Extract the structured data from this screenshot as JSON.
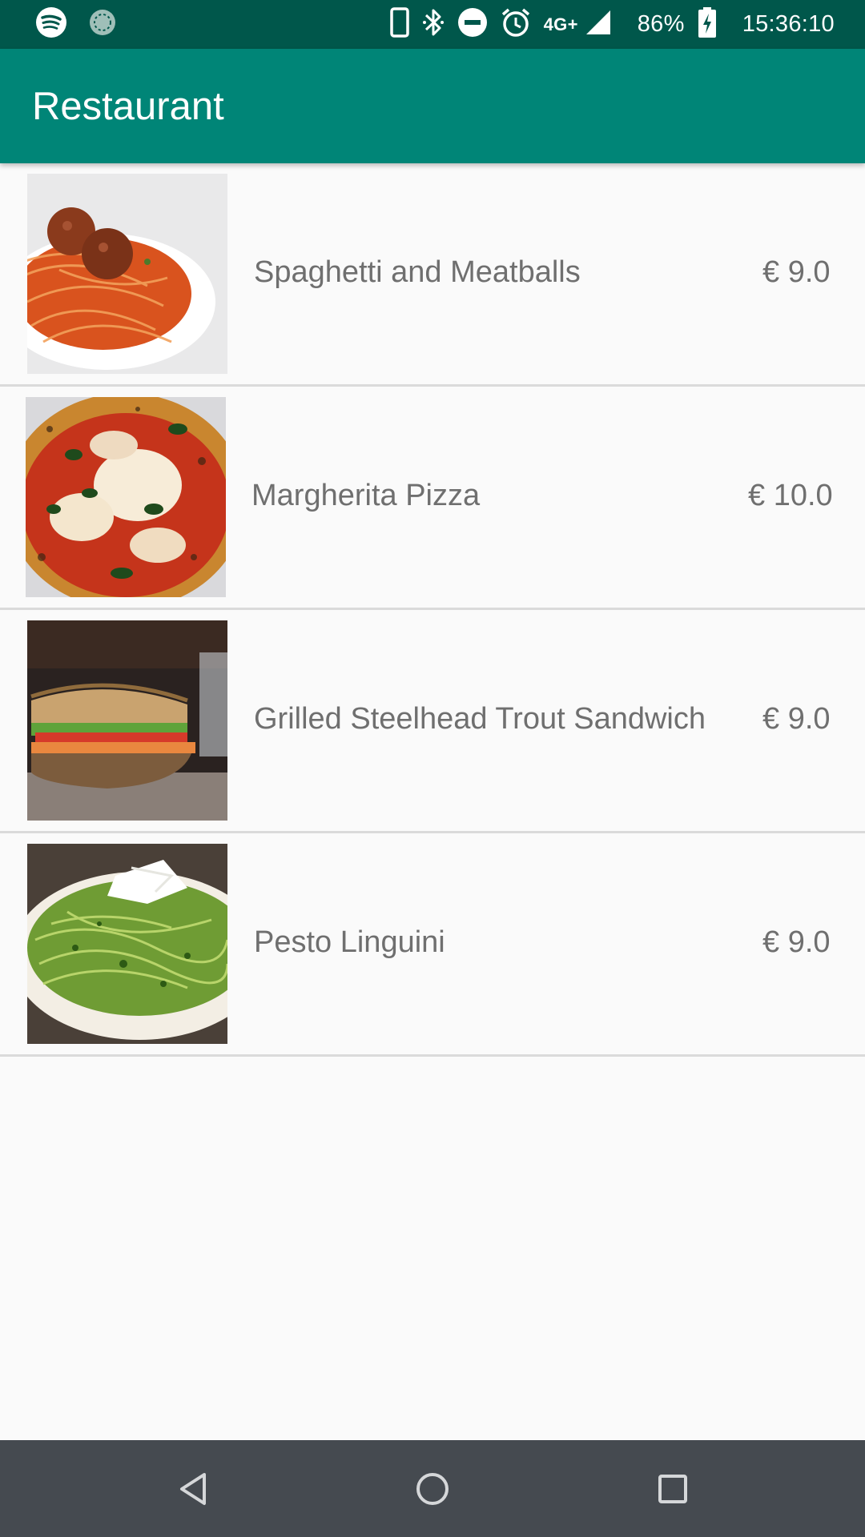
{
  "status_bar": {
    "network": "4G+",
    "battery": "86%",
    "time": "15:36:10",
    "icons": [
      "spotify-icon",
      "sync-icon",
      "phone-icon",
      "bluetooth-icon",
      "dnd-icon",
      "alarm-icon",
      "signal-icon",
      "battery-charging-icon"
    ]
  },
  "app_bar": {
    "title": "Restaurant"
  },
  "menu": {
    "items": [
      {
        "name": "Spaghetti and Meatballs",
        "price": "€ 9.0",
        "image": "spaghetti-meatballs-photo"
      },
      {
        "name": "Margherita Pizza",
        "price": "€ 10.0",
        "image": "margherita-pizza-photo"
      },
      {
        "name": "Grilled Steelhead Trout Sandwich",
        "price": "€ 9.0",
        "image": "trout-sandwich-photo"
      },
      {
        "name": "Pesto Linguini",
        "price": "€ 9.0",
        "image": "pesto-linguini-photo"
      }
    ]
  },
  "nav_bar": {
    "icons": [
      "back-icon",
      "home-icon",
      "recents-icon"
    ]
  },
  "colors": {
    "status_bar": "#00574b",
    "app_bar": "#008577",
    "background": "#fafafa",
    "text": "#6f6f6f",
    "divider": "#dadada",
    "nav_bar": "#454a50"
  }
}
